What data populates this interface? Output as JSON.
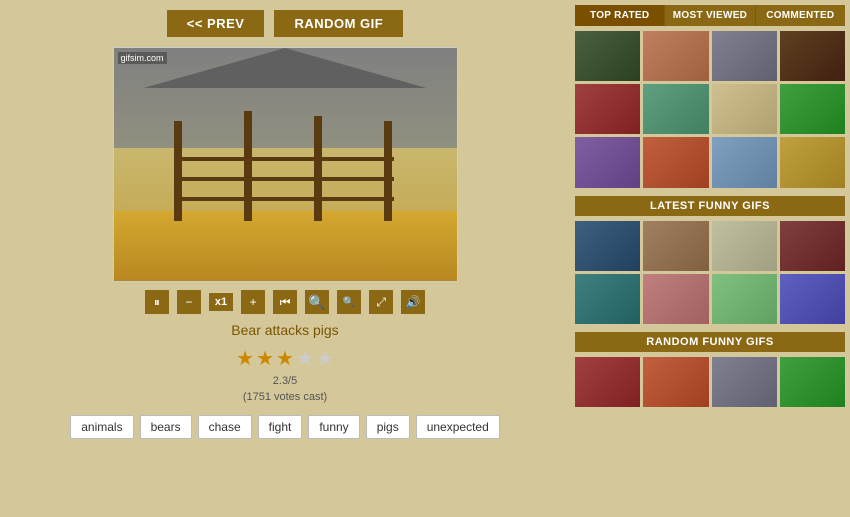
{
  "buttons": {
    "prev_label": "<< PREV",
    "random_label": "RANDOM GIF"
  },
  "gif": {
    "title": "Bear attacks pigs",
    "watermark": "gifsim.com",
    "rating": {
      "value": "2.3/5",
      "votes": "(1751 votes cast)",
      "stars": [
        {
          "type": "filled"
        },
        {
          "type": "filled"
        },
        {
          "type": "half"
        },
        {
          "type": "empty"
        },
        {
          "type": "empty"
        }
      ]
    }
  },
  "tags": [
    "animals",
    "bears",
    "chase",
    "fight",
    "funny",
    "pigs",
    "unexpected"
  ],
  "controls": {
    "pause": "⏸",
    "minus": "−",
    "x1": "x1",
    "plus": "+",
    "rewind": "⏮",
    "zoom_out": "−",
    "zoom_in": "+",
    "expand": "⤢",
    "volume": "🔊"
  },
  "sidebar": {
    "tabs": [
      "TOP RATED",
      "MOST VIEWED",
      "COMMENTED"
    ],
    "sections": {
      "latest": "LATEST FUNNY GIFS",
      "random": "RANDOM FUNNY GIFS"
    }
  }
}
